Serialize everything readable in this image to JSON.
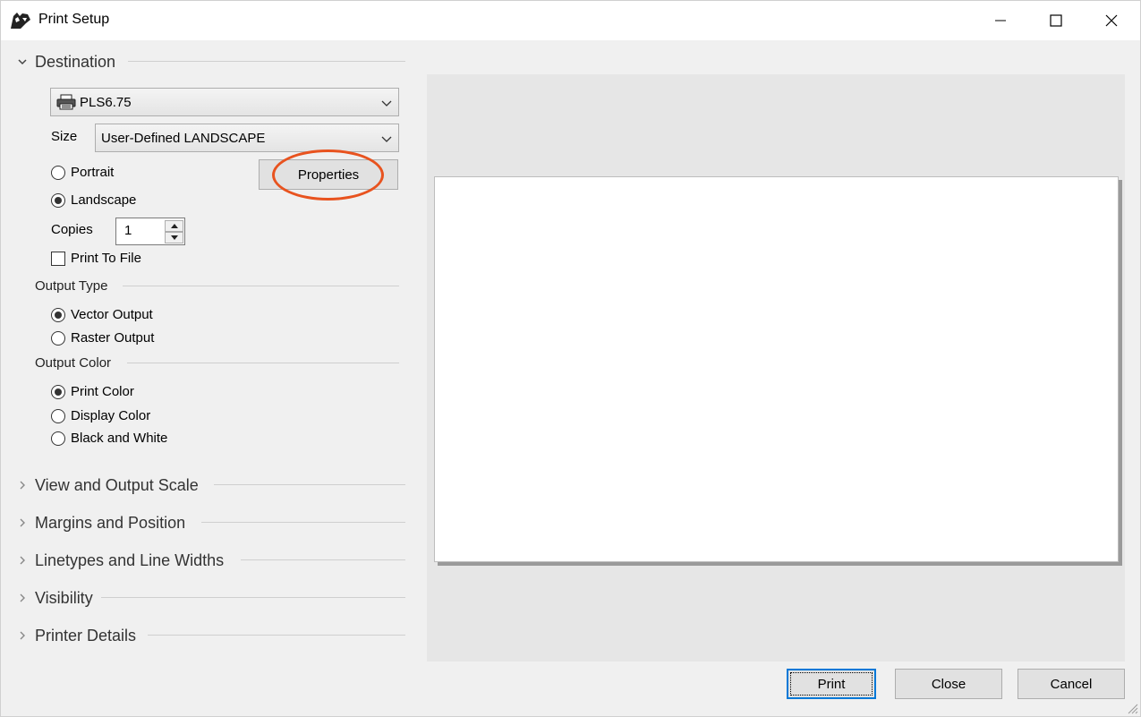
{
  "window": {
    "title": "Print Setup",
    "controls": [
      "minimize-icon",
      "maximize-icon",
      "close-icon"
    ]
  },
  "destination": {
    "section_label": "Destination",
    "printer": "PLS6.75",
    "size_label": "Size",
    "size_value": "User-Defined LANDSCAPE",
    "orientation": {
      "portrait_label": "Portrait",
      "landscape_label": "Landscape",
      "selected": "Landscape"
    },
    "properties_label": "Properties",
    "copies_label": "Copies",
    "copies_value": "1",
    "print_to_file_label": "Print To File",
    "print_to_file_checked": false
  },
  "output_type": {
    "label": "Output Type",
    "options": [
      "Vector Output",
      "Raster Output"
    ],
    "selected": "Vector Output"
  },
  "output_color": {
    "label": "Output Color",
    "options": [
      "Print Color",
      "Display Color",
      "Black and White"
    ],
    "selected": "Print Color"
  },
  "collapsed_sections": [
    "View and Output Scale",
    "Margins and Position",
    "Linetypes and Line Widths",
    "Visibility",
    "Printer Details"
  ],
  "footer": {
    "print_label": "Print",
    "close_label": "Close",
    "cancel_label": "Cancel"
  },
  "colors": {
    "highlight_circle": "#e8531f",
    "default_button_border": "#0078d7"
  }
}
